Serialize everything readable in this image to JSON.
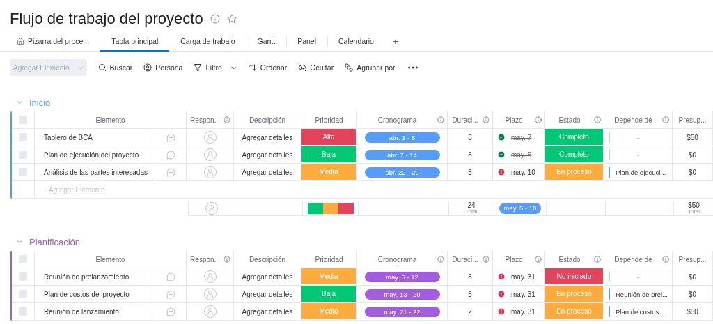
{
  "title": "Flujo de trabajo del proyecto",
  "tabs": [
    {
      "label": "Pizarra del proce...",
      "kind": "home",
      "selected": false
    },
    {
      "label": "Tabla principal",
      "kind": "view",
      "selected": true
    },
    {
      "label": "Carga de trabajo",
      "kind": "view",
      "selected": false
    },
    {
      "label": "Gantt",
      "kind": "view",
      "selected": false
    },
    {
      "label": "Panel",
      "kind": "view",
      "selected": false
    },
    {
      "label": "Calendario",
      "kind": "view",
      "selected": false
    }
  ],
  "add_tab": "+",
  "toolbar": {
    "add_button": "Agregar Elemento",
    "actions": [
      {
        "label": "Buscar",
        "kind": "search"
      },
      {
        "label": "Persona",
        "kind": "person"
      },
      {
        "label": "Filtro",
        "kind": "filter"
      },
      {
        "label": "Ordenar",
        "kind": "sort"
      },
      {
        "label": "Ocultar",
        "kind": "hide"
      },
      {
        "label": "Agrupar por",
        "kind": "group"
      }
    ]
  },
  "groups": [
    {
      "name": "Inicio",
      "color": "#579bfc",
      "checked": false,
      "columns": [
        {
          "label": "Elemento",
          "info": false
        },
        {
          "label": "Respon...",
          "info": true
        },
        {
          "label": "Descripción",
          "info": false
        },
        {
          "label": "Prioridad",
          "info": false
        },
        {
          "label": "Cronograma",
          "info": true
        },
        {
          "label": "Duraci...",
          "info": true
        },
        {
          "label": "Plazo",
          "info": true
        },
        {
          "label": "Estado",
          "info": true
        },
        {
          "label": "Depende de",
          "info": true
        },
        {
          "label": "Presup...",
          "info": false
        }
      ],
      "rows": [
        {
          "checked": false,
          "name": "Tablero de BCA",
          "description": "Agregar detalles",
          "priority": {
            "label": "Alta",
            "color": "#e2445c"
          },
          "timeline": "abr. 1 - 8",
          "duration": "8",
          "deadline": {
            "label": "may. 7",
            "kind": "done"
          },
          "status": {
            "label": "Completo",
            "color": "#00c875"
          },
          "depends": {
            "label": "-",
            "kind": "none"
          },
          "budget": "$50"
        },
        {
          "checked": false,
          "name": "Plan de ejecución del proyecto",
          "description": "Agregar detalles",
          "priority": {
            "label": "Baja",
            "color": "#00c875"
          },
          "timeline": "abr. 7 - 14",
          "duration": "8",
          "deadline": {
            "label": "may. 5",
            "kind": "done"
          },
          "status": {
            "label": "Completo",
            "color": "#00c875"
          },
          "depends": {
            "label": "-",
            "kind": "none"
          },
          "budget": "$0"
        },
        {
          "checked": false,
          "name": "Análisis de las partes interesadas",
          "description": "Agregar detalles",
          "priority": {
            "label": "Media",
            "color": "#fdab3d"
          },
          "timeline": "abr. 22 - 29",
          "duration": "8",
          "deadline": {
            "label": "may. 10",
            "kind": "overdue"
          },
          "status": {
            "label": "En proceso",
            "color": "#fdab3d"
          },
          "depends": {
            "label": "Plan de ejecuci...",
            "kind": "item"
          },
          "budget": "$0"
        }
      ],
      "add_row": "+ Agregar Elemento",
      "footer": {
        "priority_summary": [
          {
            "color": "#00c875"
          },
          {
            "color": "#fdab3d"
          },
          {
            "color": "#e2445c"
          }
        ],
        "duration_total": "24",
        "duration_caption": "Total",
        "timeline_summary": "may. 5 - 10",
        "budget_total": "$50",
        "budget_caption": "Total"
      }
    },
    {
      "name": "Planificación",
      "color": "#a25ddc",
      "checked": false,
      "columns": [
        {
          "label": "Elemento",
          "info": false
        },
        {
          "label": "Respon...",
          "info": true
        },
        {
          "label": "Descripción",
          "info": false
        },
        {
          "label": "Prioridad",
          "info": false
        },
        {
          "label": "Cronograma",
          "info": true
        },
        {
          "label": "Duraci...",
          "info": true
        },
        {
          "label": "Plazo",
          "info": true
        },
        {
          "label": "Estado",
          "info": true
        },
        {
          "label": "Depende de",
          "info": true
        },
        {
          "label": "Presup...",
          "info": false
        }
      ],
      "rows": [
        {
          "checked": false,
          "name": "Reunión de prelanzamiento",
          "description": "Agregar detalles",
          "priority": {
            "label": "Media",
            "color": "#fdab3d"
          },
          "timeline": "may. 5 - 12",
          "duration": "8",
          "deadline": {
            "label": "may. 31",
            "kind": "overdue"
          },
          "status": {
            "label": "No iniciado",
            "color": "#e2445c"
          },
          "depends": {
            "label": "-",
            "kind": "none"
          },
          "budget": "$0"
        },
        {
          "checked": false,
          "name": "Plan de costos del proyecto",
          "description": "Agregar detalles",
          "priority": {
            "label": "Baja",
            "color": "#00c875"
          },
          "timeline": "may. 13 - 20",
          "duration": "8",
          "deadline": {
            "label": "may. 31",
            "kind": "overdue"
          },
          "status": {
            "label": "En proceso",
            "color": "#fdab3d"
          },
          "depends": {
            "label": "Reunión de prel...",
            "kind": "item"
          },
          "budget": "$0"
        },
        {
          "checked": false,
          "name": "Reunión de lanzamiento",
          "description": "Agregar detalles",
          "priority": {
            "label": "Media",
            "color": "#fdab3d"
          },
          "timeline": "may. 21 - 22",
          "duration": "2",
          "deadline": {
            "label": "may. 31",
            "kind": "overdue"
          },
          "status": {
            "label": "En proceso",
            "color": "#fdab3d"
          },
          "depends": {
            "label": "Plan de costos ...",
            "kind": "item"
          },
          "budget": "$50"
        }
      ]
    }
  ]
}
